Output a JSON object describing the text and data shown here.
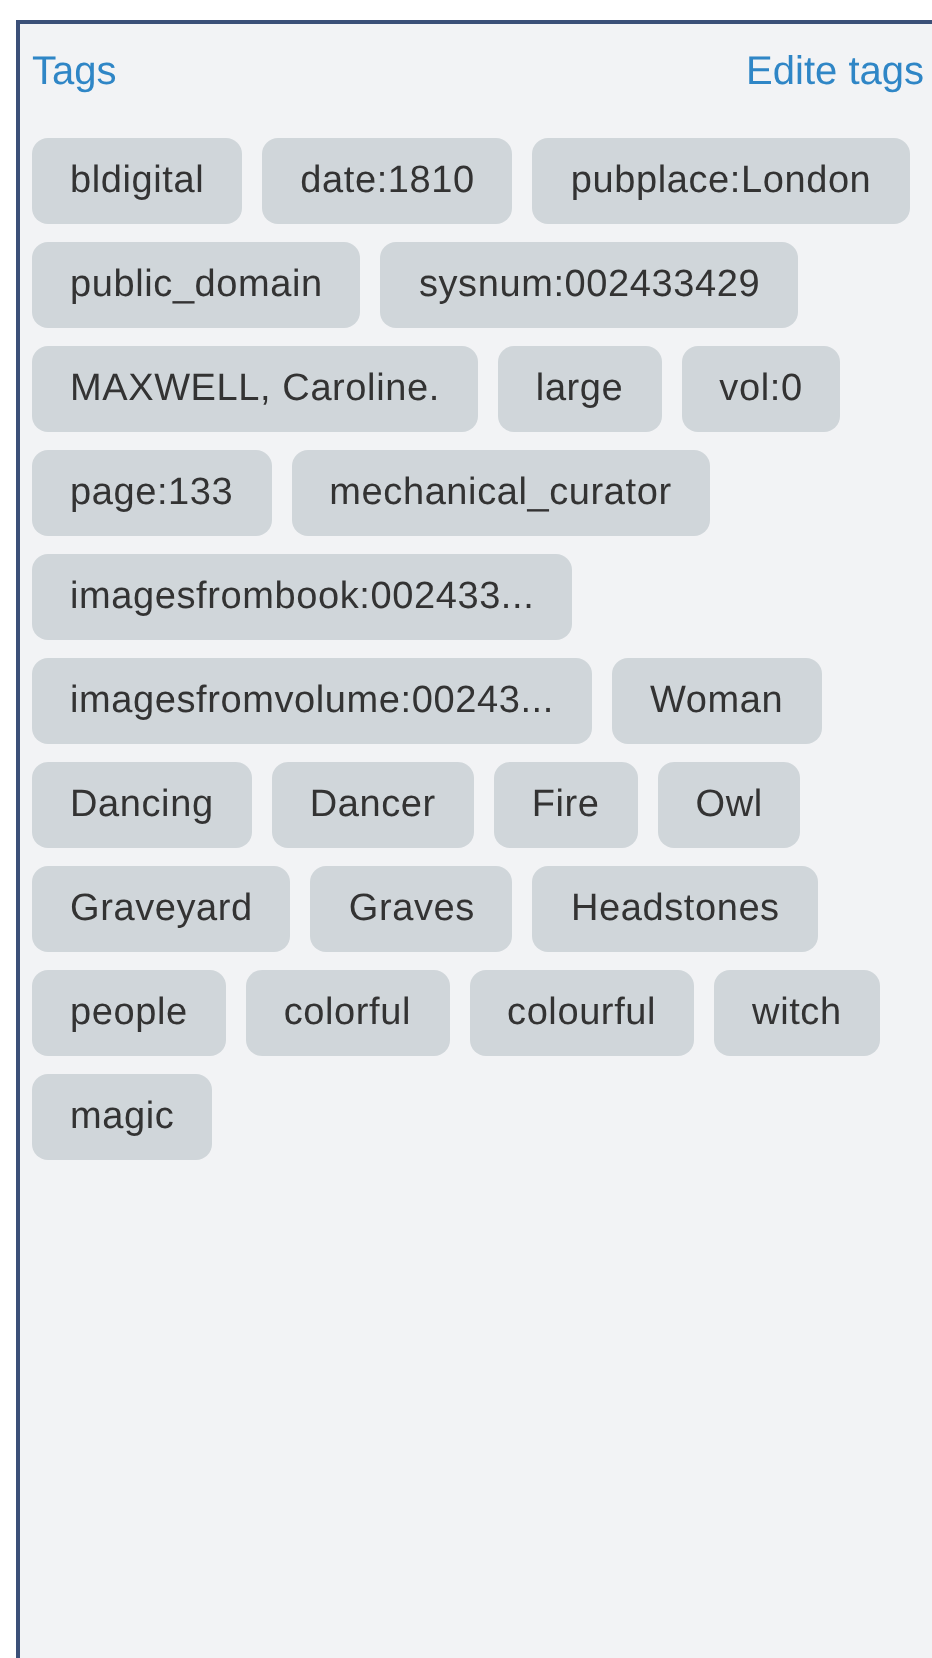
{
  "panel": {
    "title": "Tags",
    "edit_link": "Edite tags"
  },
  "tags": [
    "bldigital",
    "date:1810",
    "pubplace:London",
    "public_domain",
    "sysnum:002433429",
    "MAXWELL, Caroline.",
    "large",
    "vol:0",
    "page:133",
    "mechanical_curator",
    "imagesfrombook:002433...",
    "imagesfromvolume:00243...",
    "Woman",
    "Dancing",
    "Dancer",
    "Fire",
    "Owl",
    "Graveyard",
    "Graves",
    "Headstones",
    "people",
    "colorful",
    "colourful",
    "witch",
    "magic"
  ]
}
